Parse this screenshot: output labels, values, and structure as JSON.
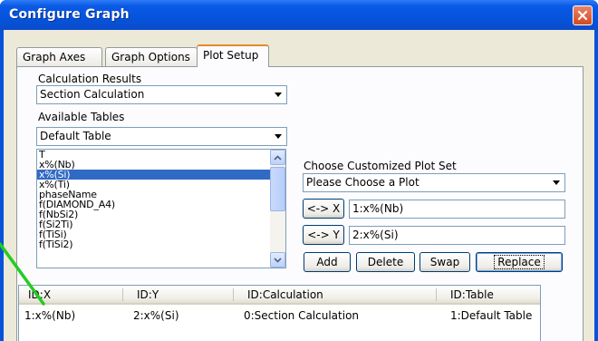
{
  "window": {
    "title": "Configure Graph",
    "close_icon": "close-icon"
  },
  "tabs": [
    {
      "label": "Graph Axes",
      "active": false
    },
    {
      "label": "Graph Options",
      "active": false
    },
    {
      "label": "Plot Setup",
      "active": true
    }
  ],
  "left": {
    "calc_results_label": "Calculation Results",
    "calc_results_value": "Section Calculation",
    "available_tables_label": "Available Tables",
    "available_tables_value": "Default Table",
    "list_items": [
      "T",
      "x%(Nb)",
      "x%(Si)",
      "x%(Ti)",
      "phaseName",
      "f(DIAMOND_A4)",
      "f(NbSi2)",
      "f(Si2Ti)",
      "f(TiSi)",
      "f(TiSi2)"
    ],
    "selected_item": "x%(Si)"
  },
  "right": {
    "custom_plot_label": "Choose Customized Plot Set",
    "custom_plot_value": "Please Choose a Plot",
    "x_button": "<-> X",
    "x_value": "1:x%(Nb)",
    "y_button": "<-> Y",
    "y_value": "2:x%(Si)",
    "add": "Add",
    "delete": "Delete",
    "swap": "Swap",
    "replace": "Replace"
  },
  "table": {
    "columns": [
      "ID:X",
      "ID:Y",
      "ID:Calculation",
      "ID:Table"
    ],
    "rows": [
      [
        "1:x%(Nb)",
        "2:x%(Si)",
        "0:Section Calculation",
        "1:Default Table"
      ]
    ]
  },
  "colors": {
    "accent": "#0a52d8",
    "selection": "#316ac5",
    "annotation_arrow": "#22cc22"
  }
}
